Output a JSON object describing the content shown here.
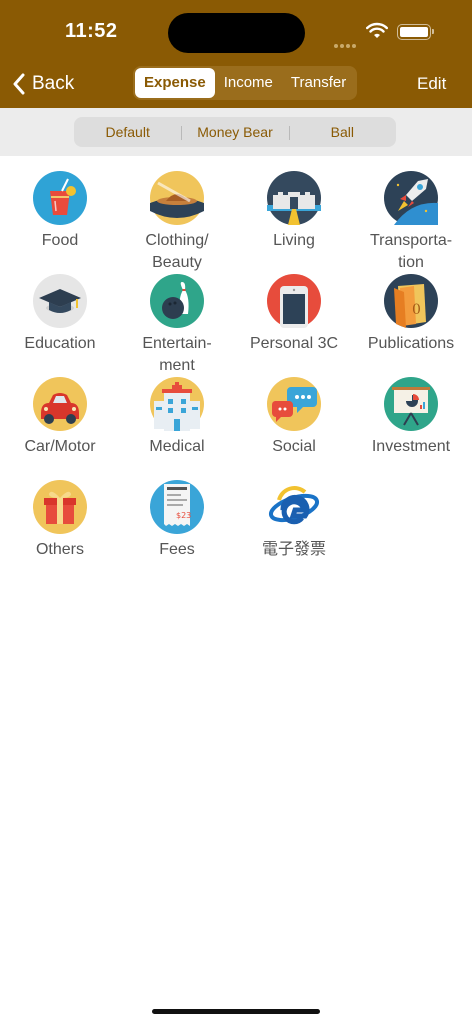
{
  "status": {
    "time": "11:52"
  },
  "nav": {
    "back_label": "Back",
    "edit_label": "Edit",
    "tabs": [
      {
        "label": "Expense",
        "active": true
      },
      {
        "label": "Income",
        "active": false
      },
      {
        "label": "Transfer",
        "active": false
      }
    ]
  },
  "theme_tabs": [
    {
      "label": "Default"
    },
    {
      "label": "Money Bear"
    },
    {
      "label": "Ball"
    }
  ],
  "categories": [
    {
      "label": "Food",
      "icon": "drink-icon"
    },
    {
      "label": "Clothing/\nBeauty",
      "icon": "hat-icon"
    },
    {
      "label": "Living",
      "icon": "house-gate-icon"
    },
    {
      "label": "Transporta-\ntion",
      "icon": "rocket-icon"
    },
    {
      "label": "Education",
      "icon": "graduation-cap-icon"
    },
    {
      "label": "Entertain-\nment",
      "icon": "bowling-icon"
    },
    {
      "label": "Personal 3C",
      "icon": "phone-icon"
    },
    {
      "label": "Publications",
      "icon": "book-icon"
    },
    {
      "label": "Car/Motor",
      "icon": "car-icon"
    },
    {
      "label": "Medical",
      "icon": "hospital-icon"
    },
    {
      "label": "Social",
      "icon": "chat-bubbles-icon"
    },
    {
      "label": "Investment",
      "icon": "presentation-icon"
    },
    {
      "label": "Others",
      "icon": "gift-icon"
    },
    {
      "label": "Fees",
      "icon": "receipt-icon"
    },
    {
      "label": "電子發票",
      "icon": "e-invoice-icon"
    }
  ],
  "colors": {
    "header": "#8a5a04",
    "accent_text": "#8a5a04"
  }
}
